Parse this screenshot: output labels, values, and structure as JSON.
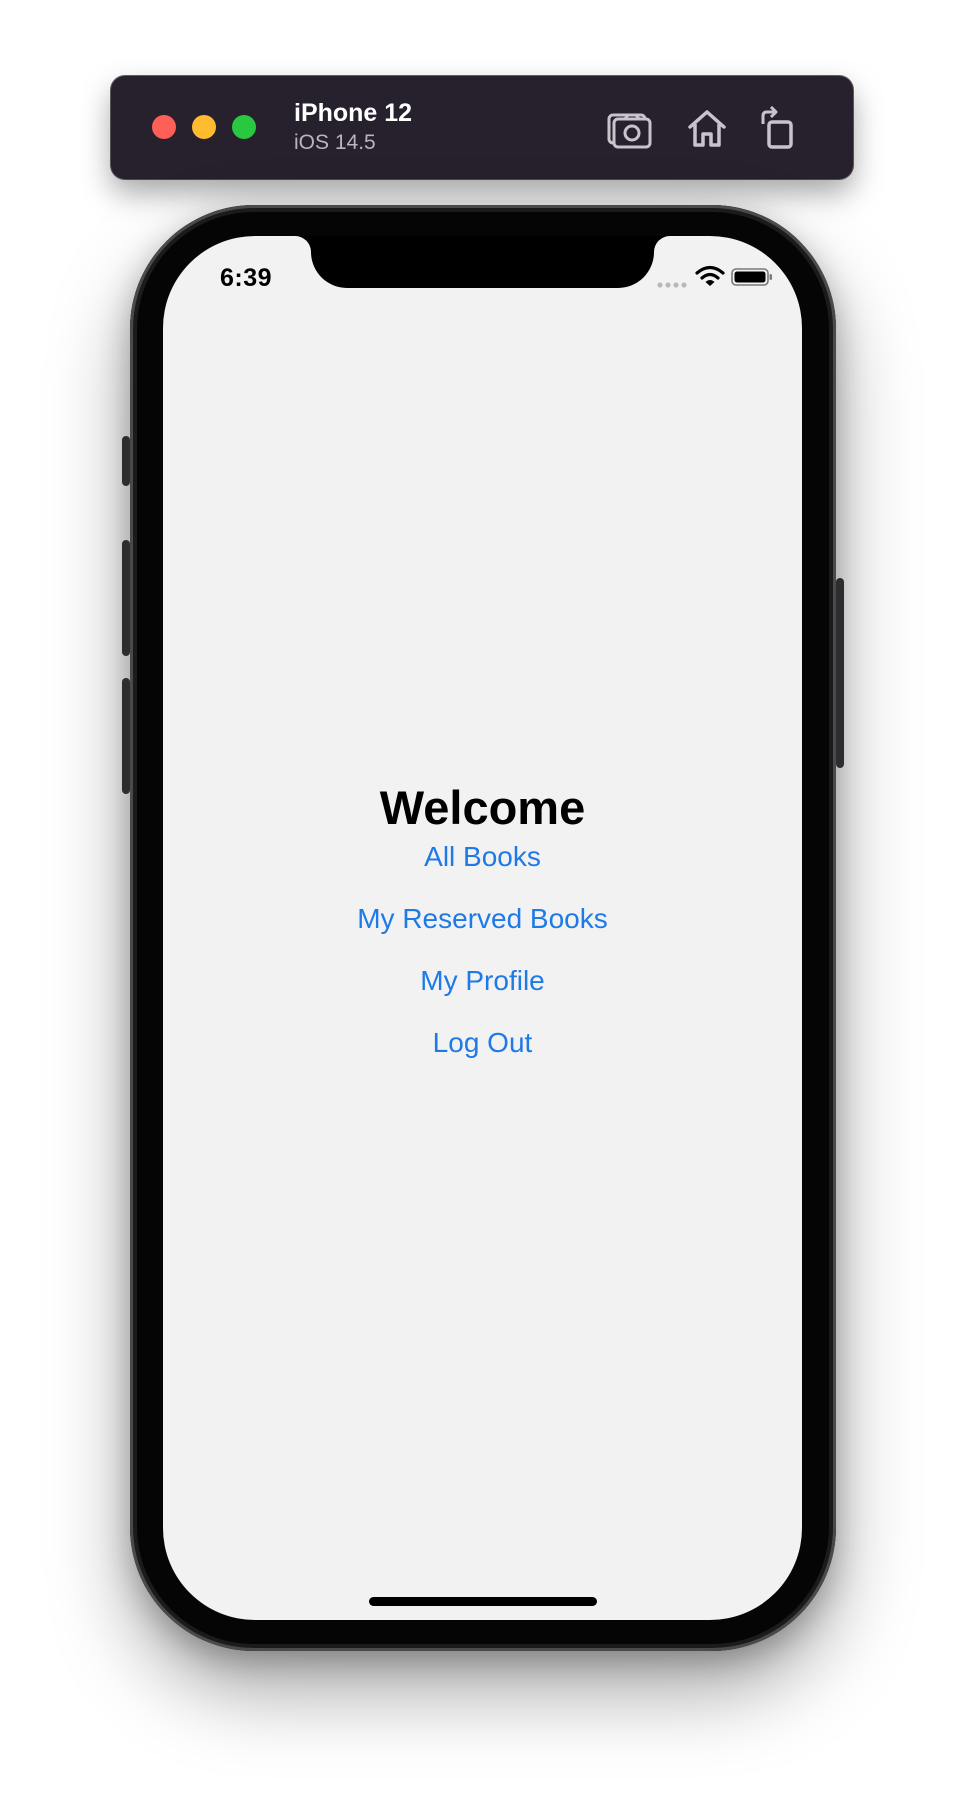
{
  "simulator": {
    "device_name": "iPhone 12",
    "os_version": "iOS 14.5",
    "tools": {
      "screenshot_icon": "camera-screenshot-icon",
      "home_icon": "home-icon",
      "rotate_icon": "rotate-icon"
    },
    "colors": {
      "bar": "#27212d",
      "close": "#fe5f57",
      "minimize": "#febc2e",
      "zoom": "#28c840"
    }
  },
  "status_bar": {
    "time": "6:39",
    "icons": [
      "signal-icon",
      "wifi-icon",
      "battery-icon"
    ]
  },
  "main": {
    "title": "Welcome",
    "links": [
      {
        "label": "All Books"
      },
      {
        "label": "My Reserved Books"
      },
      {
        "label": "My Profile"
      },
      {
        "label": "Log Out"
      }
    ],
    "link_color": "#1e7ae6",
    "background": "#f2f2f3"
  }
}
